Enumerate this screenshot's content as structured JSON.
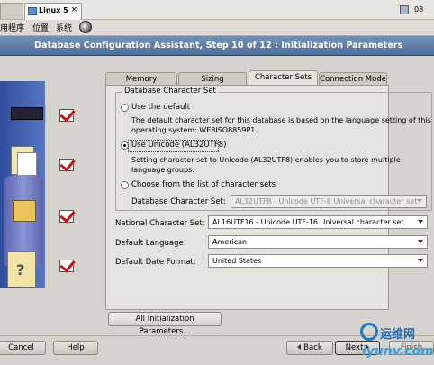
{
  "vm_tabs": {
    "active_label": "Linux 5",
    "tray_text": "08"
  },
  "menubar": {
    "items": [
      "用程序",
      "位置",
      "系统"
    ]
  },
  "window": {
    "title": "Database Configuration Assistant, Step 10 of 12 : Initialization Parameters"
  },
  "tabs": [
    {
      "label": "Memory"
    },
    {
      "label": "Sizing"
    },
    {
      "label": "Character Sets",
      "active": true
    },
    {
      "label": "Connection Mode"
    }
  ],
  "charset": {
    "legend": "Database Character Set",
    "use_default": {
      "label": "Use the default",
      "desc1": "The default character set for this database is based on the language setting of this",
      "desc2": "operating system: WE8ISO8859P1."
    },
    "use_unicode": {
      "label": "Use Unicode (AL32UTF8)",
      "selected": true,
      "desc1": "Setting character set to Unicode (AL32UTF8) enables you to store multiple",
      "desc2": "language groups."
    },
    "choose_list": {
      "label": "Choose from the list of character sets",
      "field_label": "Database Character Set:",
      "value": "AL32UTF8 - Unicode UTF-8 Universal character set"
    }
  },
  "fields": {
    "national_label": "National Character Set:",
    "national_value": "AL16UTF16 - Unicode UTF-16 Universal character set",
    "language_label": "Default Language:",
    "language_value": "American",
    "date_label": "Default Date Format:",
    "date_value": "United States"
  },
  "buttons": {
    "all_params": "All Initialization Parameters...",
    "cancel": "Cancel",
    "help": "Help",
    "back": "Back",
    "next": "Next",
    "finish": "Finish"
  },
  "watermark": {
    "cn": "运维网",
    "en": "iyunv.com"
  },
  "colors": {
    "titlebar": "#5d7aa6",
    "check_red": "#c81414",
    "watermark_blue": "#1e78c8"
  }
}
